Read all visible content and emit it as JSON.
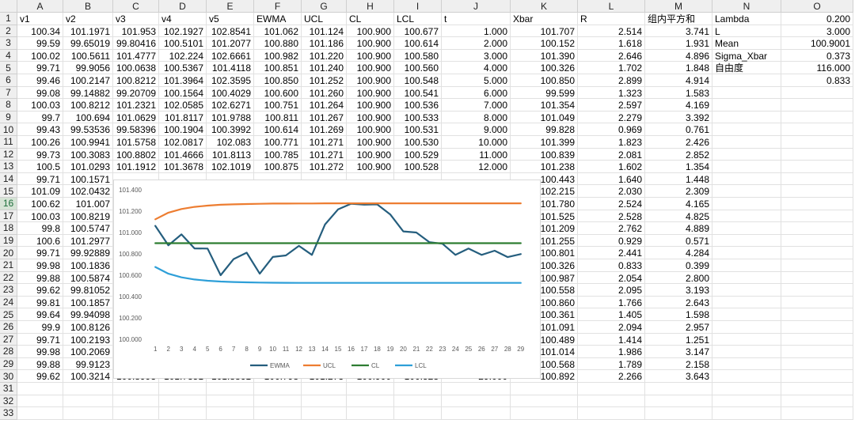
{
  "columns": [
    "A",
    "B",
    "C",
    "D",
    "E",
    "F",
    "G",
    "H",
    "I",
    "J",
    "K",
    "L",
    "M",
    "N",
    "O"
  ],
  "row_numbers": [
    "1",
    "2",
    "3",
    "4",
    "5",
    "6",
    "7",
    "8",
    "9",
    "10",
    "11",
    "12",
    "13",
    "14",
    "15",
    "16",
    "17",
    "18",
    "19",
    "20",
    "21",
    "22",
    "23",
    "24",
    "25",
    "26",
    "27",
    "28",
    "29",
    "30",
    "31",
    "32",
    "33"
  ],
  "selected_row": "16",
  "headers": [
    "v1",
    "v2",
    "v3",
    "v4",
    "v5",
    "EWMA",
    "UCL",
    "CL",
    "LCL",
    "t",
    "Xbar",
    "R",
    "组内平方和",
    "Lambda",
    "0.200"
  ],
  "rows": [
    [
      "100.34",
      "101.1971",
      "101.953",
      "102.1927",
      "102.8541",
      "101.062",
      "101.124",
      "100.900",
      "100.677",
      "1.000",
      "101.707",
      "2.514",
      "3.741",
      "L",
      "3.000"
    ],
    [
      "99.59",
      "99.65019",
      "99.80416",
      "100.5101",
      "101.2077",
      "100.880",
      "101.186",
      "100.900",
      "100.614",
      "2.000",
      "100.152",
      "1.618",
      "1.931",
      "Mean",
      "100.9001"
    ],
    [
      "100.02",
      "100.5611",
      "101.4777",
      "102.224",
      "102.6661",
      "100.982",
      "101.220",
      "100.900",
      "100.580",
      "3.000",
      "101.390",
      "2.646",
      "4.896",
      "Sigma_Xbar",
      "0.373"
    ],
    [
      "99.71",
      "99.9056",
      "100.0638",
      "100.5367",
      "101.4118",
      "100.851",
      "101.240",
      "100.900",
      "100.560",
      "4.000",
      "100.326",
      "1.702",
      "1.848",
      "自由度",
      "116.000"
    ],
    [
      "99.46",
      "100.2147",
      "100.8212",
      "101.3964",
      "102.3595",
      "100.850",
      "101.252",
      "100.900",
      "100.548",
      "5.000",
      "100.850",
      "2.899",
      "4.914",
      "",
      "0.833"
    ],
    [
      "99.08",
      "99.14882",
      "99.20709",
      "100.1564",
      "100.4029",
      "100.600",
      "101.260",
      "100.900",
      "100.541",
      "6.000",
      "99.599",
      "1.323",
      "1.583",
      "",
      ""
    ],
    [
      "100.03",
      "100.8212",
      "101.2321",
      "102.0585",
      "102.6271",
      "100.751",
      "101.264",
      "100.900",
      "100.536",
      "7.000",
      "101.354",
      "2.597",
      "4.169",
      "",
      ""
    ],
    [
      "99.7",
      "100.694",
      "101.0629",
      "101.8117",
      "101.9788",
      "100.811",
      "101.267",
      "100.900",
      "100.533",
      "8.000",
      "101.049",
      "2.279",
      "3.392",
      "",
      ""
    ],
    [
      "99.43",
      "99.53536",
      "99.58396",
      "100.1904",
      "100.3992",
      "100.614",
      "101.269",
      "100.900",
      "100.531",
      "9.000",
      "99.828",
      "0.969",
      "0.761",
      "",
      ""
    ],
    [
      "100.26",
      "100.9941",
      "101.5758",
      "102.0817",
      "102.083",
      "100.771",
      "101.271",
      "100.900",
      "100.530",
      "10.000",
      "101.399",
      "1.823",
      "2.426",
      "",
      ""
    ],
    [
      "99.73",
      "100.3083",
      "100.8802",
      "101.4666",
      "101.8113",
      "100.785",
      "101.271",
      "100.900",
      "100.529",
      "11.000",
      "100.839",
      "2.081",
      "2.852",
      "",
      ""
    ],
    [
      "100.5",
      "101.0293",
      "101.1912",
      "101.3678",
      "102.1019",
      "100.875",
      "101.272",
      "100.900",
      "100.528",
      "12.000",
      "101.238",
      "1.602",
      "1.354",
      "",
      ""
    ],
    [
      "99.71",
      "100.1571",
      "",
      "",
      "",
      "",
      "",
      "",
      "",
      "",
      "100.443",
      "1.640",
      "1.448",
      "",
      ""
    ],
    [
      "101.09",
      "102.0432",
      "",
      "",
      "",
      "",
      "",
      "",
      "",
      "",
      "102.215",
      "2.030",
      "2.309",
      "",
      ""
    ],
    [
      "100.62",
      "101.007",
      "",
      "",
      "",
      "",
      "",
      "",
      "",
      "",
      "101.780",
      "2.524",
      "4.165",
      "",
      ""
    ],
    [
      "100.03",
      "100.8219",
      "",
      "",
      "",
      "",
      "",
      "",
      "",
      "",
      "101.525",
      "2.528",
      "4.825",
      "",
      ""
    ],
    [
      "99.8",
      "100.5747",
      "",
      "",
      "",
      "",
      "",
      "",
      "",
      "",
      "101.209",
      "2.762",
      "4.889",
      "",
      ""
    ],
    [
      "100.6",
      "101.2977",
      "",
      "",
      "",
      "",
      "",
      "",
      "",
      "",
      "101.255",
      "0.929",
      "0.571",
      "",
      ""
    ],
    [
      "99.71",
      "99.92889",
      "",
      "",
      "",
      "",
      "",
      "",
      "",
      "",
      "100.801",
      "2.441",
      "4.284",
      "",
      ""
    ],
    [
      "99.98",
      "100.1836",
      "",
      "",
      "",
      "",
      "",
      "",
      "",
      "",
      "100.326",
      "0.833",
      "0.399",
      "",
      ""
    ],
    [
      "99.88",
      "100.5874",
      "",
      "",
      "",
      "",
      "",
      "",
      "",
      "",
      "100.987",
      "2.054",
      "2.800",
      "",
      ""
    ],
    [
      "99.62",
      "99.81052",
      "",
      "",
      "",
      "",
      "",
      "",
      "",
      "",
      "100.558",
      "2.095",
      "3.193",
      "",
      ""
    ],
    [
      "99.81",
      "100.1857",
      "",
      "",
      "",
      "",
      "",
      "",
      "",
      "",
      "100.860",
      "1.766",
      "2.643",
      "",
      ""
    ],
    [
      "99.64",
      "99.94098",
      "",
      "",
      "",
      "",
      "",
      "",
      "",
      "",
      "100.361",
      "1.405",
      "1.598",
      "",
      ""
    ],
    [
      "99.9",
      "100.8126",
      "",
      "",
      "",
      "",
      "",
      "",
      "",
      "",
      "101.091",
      "2.094",
      "2.957",
      "",
      ""
    ],
    [
      "99.71",
      "100.2193",
      "",
      "",
      "",
      "",
      "",
      "",
      "",
      "",
      "100.489",
      "1.414",
      "1.251",
      "",
      ""
    ],
    [
      "99.98",
      "100.2069",
      "",
      "",
      "",
      "",
      "",
      "",
      "",
      "",
      "101.014",
      "1.986",
      "3.147",
      "",
      ""
    ],
    [
      "99.88",
      "99.9123",
      "",
      "",
      "",
      "",
      "",
      "",
      "",
      "",
      "100.568",
      "1.789",
      "2.158",
      "",
      ""
    ],
    [
      "99.62",
      "100.3214",
      "100.8993",
      "101.7351",
      "101.8861",
      "100.798",
      "101.273",
      "100.900",
      "100.528",
      "29.000",
      "100.892",
      "2.266",
      "3.643",
      "",
      ""
    ],
    [
      "",
      "",
      "",
      "",
      "",
      "",
      "",
      "",
      "",
      "",
      "",
      "",
      "",
      "",
      ""
    ],
    [
      "",
      "",
      "",
      "",
      "",
      "",
      "",
      "",
      "",
      "",
      "",
      "",
      "",
      "",
      ""
    ],
    [
      "",
      "",
      "",
      "",
      "",
      "",
      "",
      "",
      "",
      "",
      "",
      "",
      "",
      "",
      ""
    ]
  ],
  "chart_data": {
    "type": "line",
    "title": "",
    "xlabel": "",
    "ylabel": "",
    "categories": [
      "1",
      "2",
      "3",
      "4",
      "5",
      "6",
      "7",
      "8",
      "9",
      "10",
      "11",
      "12",
      "13",
      "14",
      "15",
      "16",
      "17",
      "18",
      "19",
      "20",
      "21",
      "22",
      "23",
      "24",
      "25",
      "26",
      "27",
      "28",
      "29"
    ],
    "ylim": [
      100.0,
      101.4
    ],
    "yticks": [
      "101.400",
      "101.200",
      "101.000",
      "100.800",
      "100.600",
      "100.400",
      "100.200",
      "100.000"
    ],
    "legend_position": "bottom",
    "grid": false,
    "series": [
      {
        "name": "EWMA",
        "color": "#255e7e",
        "values": [
          101.062,
          100.88,
          100.982,
          100.851,
          100.85,
          100.6,
          100.751,
          100.811,
          100.614,
          100.771,
          100.785,
          100.875,
          100.79,
          101.075,
          101.216,
          101.27,
          101.261,
          101.264,
          101.17,
          101.01,
          101.0,
          100.91,
          100.895,
          100.79,
          100.85,
          100.79,
          100.83,
          100.77,
          100.798
        ]
      },
      {
        "name": "UCL",
        "color": "#ed7d31",
        "values": [
          101.124,
          101.186,
          101.22,
          101.24,
          101.252,
          101.26,
          101.264,
          101.267,
          101.269,
          101.271,
          101.271,
          101.272,
          101.272,
          101.273,
          101.273,
          101.273,
          101.273,
          101.273,
          101.273,
          101.273,
          101.273,
          101.273,
          101.273,
          101.273,
          101.273,
          101.273,
          101.273,
          101.273,
          101.273
        ]
      },
      {
        "name": "CL",
        "color": "#2e7d32",
        "values": [
          100.9,
          100.9,
          100.9,
          100.9,
          100.9,
          100.9,
          100.9,
          100.9,
          100.9,
          100.9,
          100.9,
          100.9,
          100.9,
          100.9,
          100.9,
          100.9,
          100.9,
          100.9,
          100.9,
          100.9,
          100.9,
          100.9,
          100.9,
          100.9,
          100.9,
          100.9,
          100.9,
          100.9,
          100.9
        ]
      },
      {
        "name": "LCL",
        "color": "#2e9fd8",
        "values": [
          100.677,
          100.614,
          100.58,
          100.56,
          100.548,
          100.541,
          100.536,
          100.533,
          100.531,
          100.53,
          100.529,
          100.528,
          100.528,
          100.528,
          100.528,
          100.528,
          100.528,
          100.528,
          100.528,
          100.528,
          100.528,
          100.528,
          100.528,
          100.528,
          100.528,
          100.528,
          100.528,
          100.528,
          100.528
        ]
      }
    ]
  }
}
